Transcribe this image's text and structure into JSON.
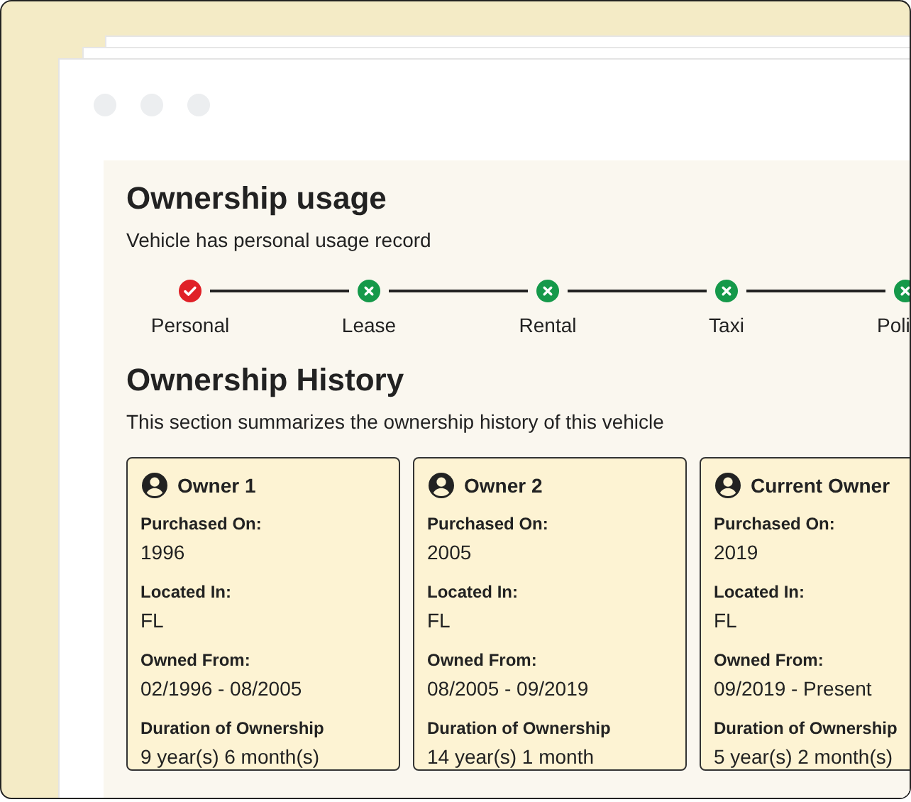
{
  "usage": {
    "title": "Ownership usage",
    "subtitle": "Vehicle has personal usage record",
    "steps": [
      {
        "label": "Personal",
        "recorded": true
      },
      {
        "label": "Lease",
        "recorded": false
      },
      {
        "label": "Rental",
        "recorded": false
      },
      {
        "label": "Taxi",
        "recorded": false
      },
      {
        "label": "Poli",
        "recorded": false
      }
    ]
  },
  "history": {
    "title": "Ownership History",
    "subtitle": "This section summarizes the ownership history of this vehicle",
    "owners": [
      {
        "name": "Owner 1",
        "fields": [
          {
            "label": "Purchased On:",
            "value": "1996"
          },
          {
            "label": "Located In:",
            "value": "FL"
          },
          {
            "label": "Owned From:",
            "value": "02/1996 - 08/2005"
          },
          {
            "label": "Duration of Ownership",
            "value": "9 year(s) 6 month(s)"
          }
        ]
      },
      {
        "name": "Owner 2",
        "fields": [
          {
            "label": "Purchased On:",
            "value": "2005"
          },
          {
            "label": "Located In:",
            "value": "FL"
          },
          {
            "label": "Owned From:",
            "value": "08/2005 - 09/2019"
          },
          {
            "label": "Duration of Ownership",
            "value": "14 year(s) 1 month"
          }
        ]
      },
      {
        "name": "Current Owner",
        "fields": [
          {
            "label": "Purchased On:",
            "value": "2019"
          },
          {
            "label": "Located In:",
            "value": "FL"
          },
          {
            "label": "Owned From:",
            "value": "09/2019 - Present"
          },
          {
            "label": "Duration of Ownership",
            "value": "5 year(s) 2 month(s)"
          }
        ]
      }
    ]
  }
}
